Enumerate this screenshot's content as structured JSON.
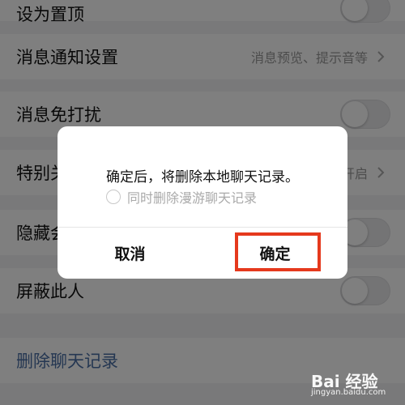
{
  "settings": {
    "top_partial": "设为置顶",
    "notify": {
      "label": "消息通知设置",
      "value": "消息预览、提示音等"
    },
    "dnd": {
      "label": "消息免打扰"
    },
    "special": {
      "label": "特别关",
      "value": "开启"
    },
    "hide": {
      "label": "隐藏会"
    },
    "block": {
      "label": "屏蔽此人"
    },
    "delete_history": {
      "label": "删除聊天记录"
    }
  },
  "dialog": {
    "message": "确定后，将删除本地聊天记录。",
    "option_label": "同时删除漫游聊天记录",
    "cancel_label": "取消",
    "confirm_label": "确定"
  },
  "watermark": {
    "logo": "Bai 经验",
    "url": "jingyan.baidu.com"
  },
  "colors": {
    "highlight": "#e5391d",
    "link": "#4a6fa5"
  }
}
